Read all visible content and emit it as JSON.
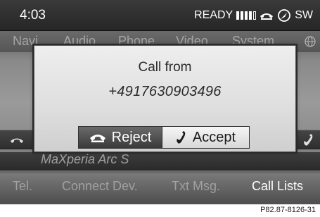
{
  "status": {
    "time": "4:03",
    "ready_label": "READY",
    "signal_bars_filled": 4,
    "signal_bars_total": 5,
    "icons": [
      "signal-icon",
      "phone-icon",
      "compass-icon"
    ],
    "direction": "SW"
  },
  "main_menu": {
    "items": [
      "Navi",
      "Audio",
      "Phone",
      "Video",
      "System"
    ],
    "globe_icon": "globe-icon"
  },
  "background_list": {
    "contact_name": "MaXperia Arc S"
  },
  "dialog": {
    "title": "Call from",
    "number": "+4917630903496",
    "reject_label": "Reject",
    "accept_label": "Accept",
    "reject_icon": "hang-up-icon",
    "accept_icon": "call-accept-icon"
  },
  "sub_menu": {
    "items": [
      "Tel.",
      "Connect Dev.",
      "Txt Msg.",
      "Call Lists"
    ],
    "active": "Call Lists"
  },
  "caption": "P82.87-8126-31"
}
